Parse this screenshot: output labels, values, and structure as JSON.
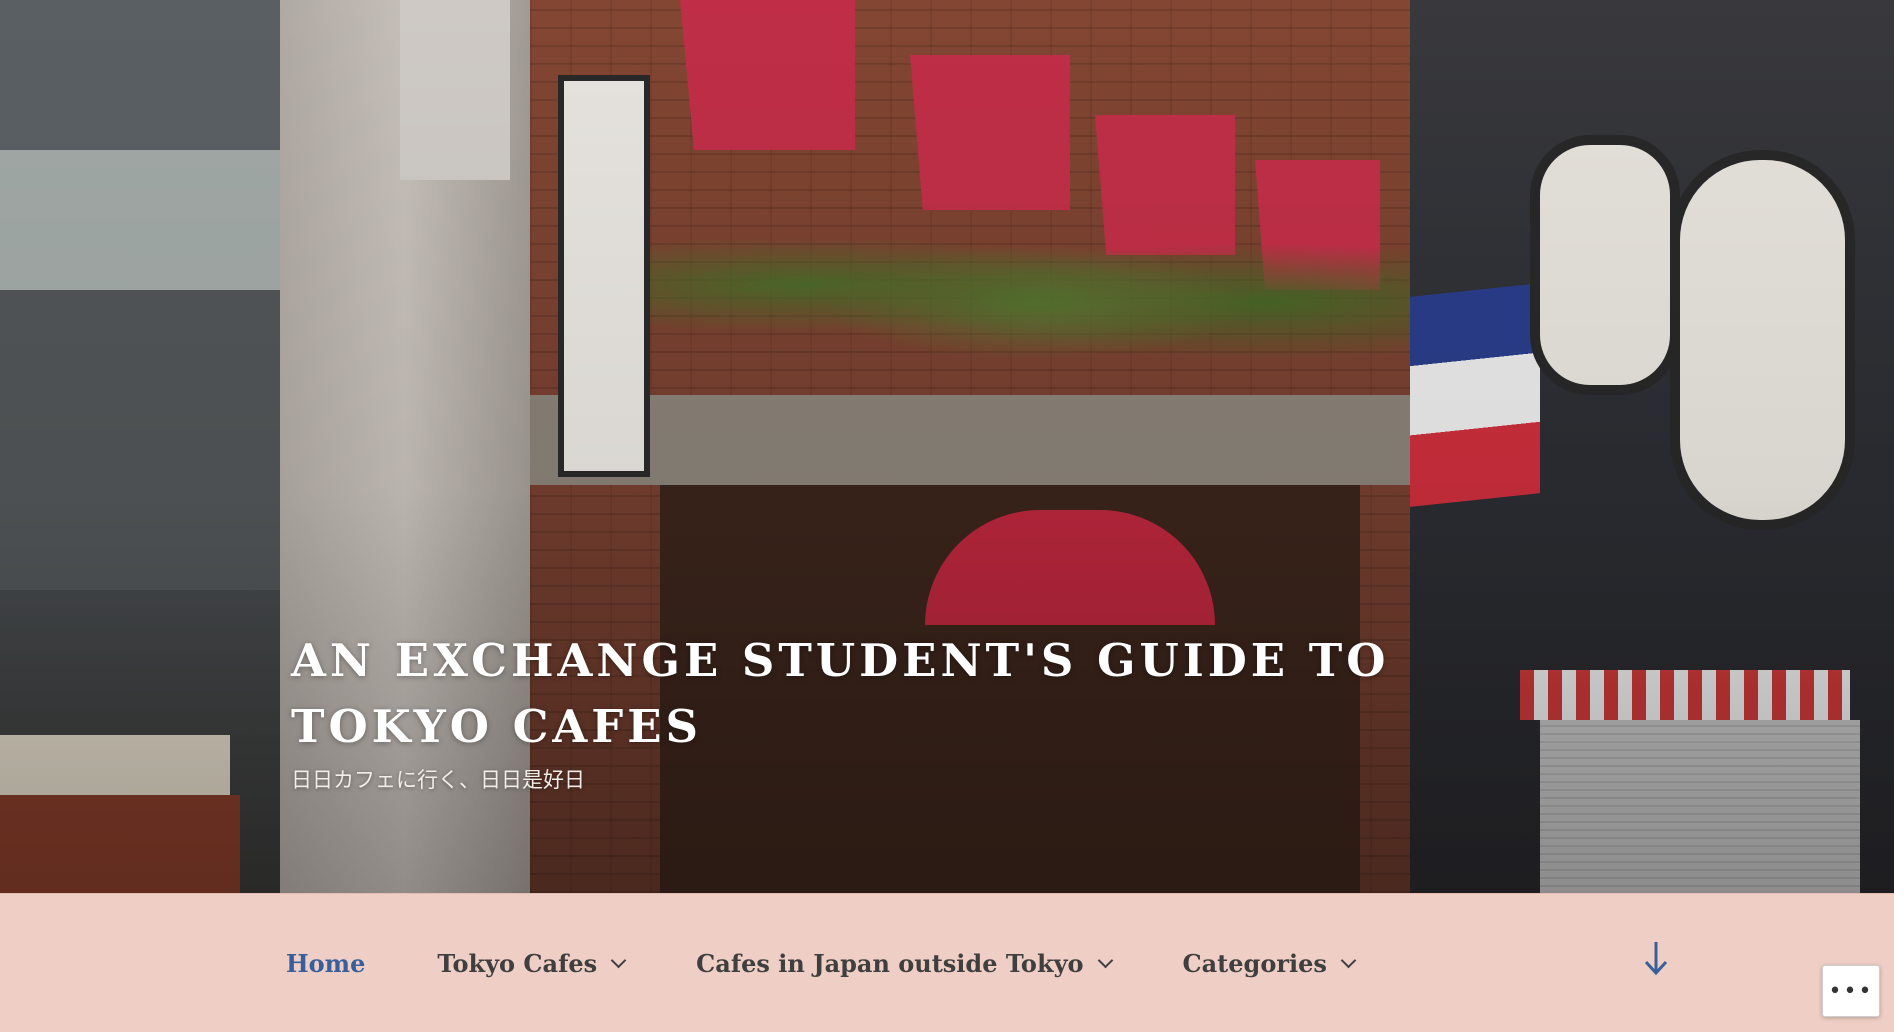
{
  "header": {
    "site_title": "AN EXCHANGE STUDENT'S GUIDE TO TOKYO CAFES",
    "site_description": "日日カフェに行く、日日是好日",
    "image_description": "Street view of a brick cafe building with red awnings"
  },
  "nav": {
    "items": [
      {
        "label": "Home",
        "current": true,
        "has_submenu": false
      },
      {
        "label": "Tokyo Cafes",
        "current": false,
        "has_submenu": true
      },
      {
        "label": "Cafes in Japan outside Tokyo",
        "current": false,
        "has_submenu": true
      },
      {
        "label": "Categories",
        "current": false,
        "has_submenu": true
      }
    ],
    "scroll_icon": "arrow-down-icon"
  },
  "floating": {
    "more_label": "•••"
  },
  "colors": {
    "nav_background": "#efcfc5",
    "nav_text": "#3f3f3f",
    "nav_current": "#375f9b",
    "title_text": "#ffffff"
  }
}
